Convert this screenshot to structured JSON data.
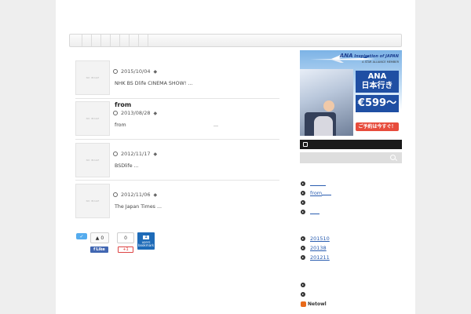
{
  "navbar": {
    "segments": 8
  },
  "posts": [
    {
      "title": "",
      "date": "2015/10/04",
      "excerpt": "NHK BS Dlife CINEMA SHOW! ...",
      "thumb_label": "NO IMAGE"
    },
    {
      "title": "from",
      "date": "2013/08/28",
      "excerpt": "from",
      "trailing": "...",
      "thumb_label": "NO IMAGE"
    },
    {
      "title": "",
      "date": "2012/11/17",
      "excerpt": "BSDlife ...",
      "thumb_label": "NO IMAGE"
    },
    {
      "title": "",
      "date": "2012/11/06",
      "excerpt": "The Japan Times ...",
      "thumb_label": "NO IMAGE"
    }
  ],
  "share": {
    "like_count": "0",
    "fb_like_label": "Like",
    "gplus_count": "0",
    "gplus_label": "+1",
    "hatena_count": "1",
    "hatena_users": "users",
    "hatena_label": "bookmark"
  },
  "ad": {
    "brand": "ANA",
    "brand_tagline": "Inspiration of JAPAN",
    "alliance": "A STAR ALLIANCE MEMBER",
    "destination_line1": "ANA",
    "destination_line2": "日本行き",
    "price": "€599〜",
    "cta": "ご予約は今すぐ！"
  },
  "sidebar": {
    "recent": [
      {
        "label": ""
      },
      {
        "label": "from"
      },
      {
        "label": ""
      },
      {
        "label": ""
      }
    ],
    "archives": [
      {
        "label": "201510"
      },
      {
        "label": "20138"
      },
      {
        "label": "201211"
      }
    ],
    "misc": [
      {
        "label": ""
      },
      {
        "label": ""
      }
    ],
    "netowl_label": "Netowl"
  },
  "colors": {
    "twitter": "#55acee",
    "facebook": "#4267b2",
    "hatena": "#1e6bb8",
    "link": "#2a5db0",
    "ad_blue": "#1f4fa3",
    "cta_red": "#e74c3c"
  }
}
